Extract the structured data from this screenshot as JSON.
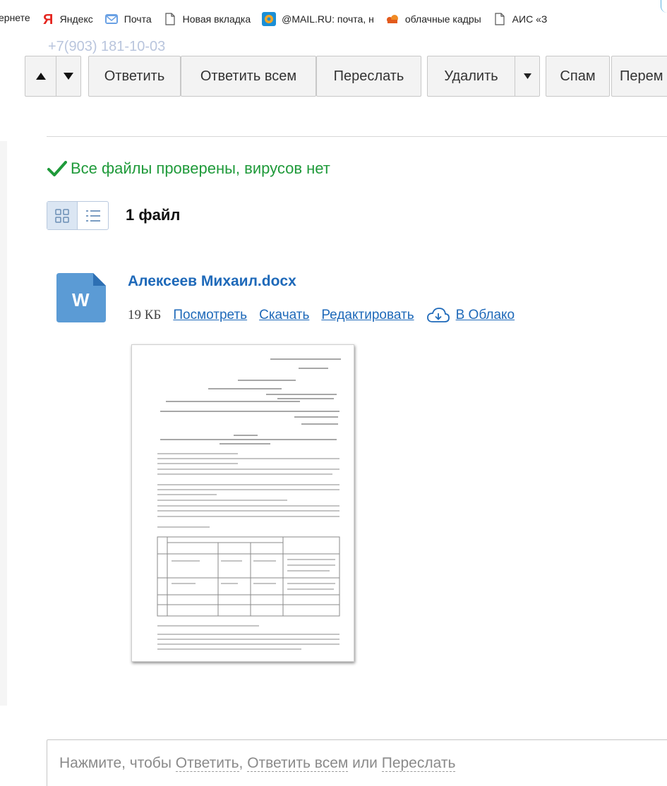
{
  "bookmarks": [
    {
      "label": "ернете",
      "icon": "none"
    },
    {
      "label": "Яндекс",
      "icon": "yandex-icon"
    },
    {
      "label": "Почта",
      "icon": "mail-icon"
    },
    {
      "label": "Новая вкладка",
      "icon": "page-icon"
    },
    {
      "label": "@MAIL.RU: почта, н",
      "icon": "mailru-icon"
    },
    {
      "label": "облачные кадры",
      "icon": "cloud-staff-icon"
    },
    {
      "label": "АИС «З",
      "icon": "page-icon"
    }
  ],
  "header": {
    "phone": "+7(903) 181-10-03"
  },
  "toolbar": {
    "reply": "Ответить",
    "reply_all": "Ответить всем",
    "forward": "Переслать",
    "delete": "Удалить",
    "spam": "Спам",
    "move": "Перем"
  },
  "virus_check": {
    "text": "Все файлы проверены, вирусов нет",
    "color": "#1f9a3a"
  },
  "attachments": {
    "count_label": "1 файл",
    "file": {
      "name": "Алексеев Михаил.docx",
      "size": "19 КБ",
      "view": "Посмотреть",
      "download": "Скачать",
      "edit": "Редактировать",
      "cloud": "В Облако",
      "icon": "word-doc-icon"
    }
  },
  "reply_box": {
    "prefix": "Нажмите, чтобы ",
    "reply": "Ответить",
    "sep": ", ",
    "reply_all": "Ответить всем",
    "or": " или ",
    "forward": "Переслать"
  },
  "colors": {
    "link": "#1e69b9",
    "success": "#1f9a3a",
    "word": "#5b9bd5"
  }
}
